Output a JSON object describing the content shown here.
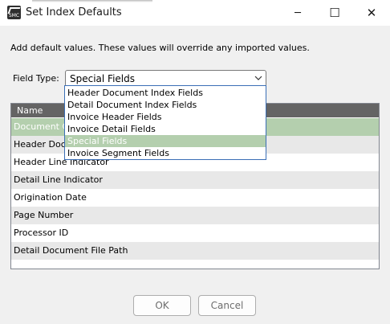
{
  "window": {
    "icon": "app-icon",
    "icon_text": "SMC",
    "title": "Set Index Defaults",
    "controls": {
      "minimize": "─",
      "maximize": "☐",
      "close": "✕"
    }
  },
  "description": "Add default values. These values will override any imported values.",
  "field_type": {
    "label": "Field Type:",
    "selected": "Special Fields",
    "options": [
      "Header Document Index Fields",
      "Detail Document Index Fields",
      "Invoice Header Fields",
      "Invoice Detail Fields",
      "Special Fields",
      "Invoice Segment Fields"
    ],
    "highlighted_index": 4
  },
  "grid": {
    "header": "Name",
    "rows": [
      "Document Class",
      "Header Document",
      "Header Line Indicator",
      "Detail Line Indicator",
      "Origination Date",
      "Page Number",
      "Processor ID",
      "Detail Document File Path"
    ],
    "selected_index": 0
  },
  "buttons": {
    "ok": "OK",
    "cancel": "Cancel"
  },
  "colors": {
    "selection": "#b4cfae",
    "header_bg": "#646464",
    "dropdown_border": "#3b6fb6"
  }
}
